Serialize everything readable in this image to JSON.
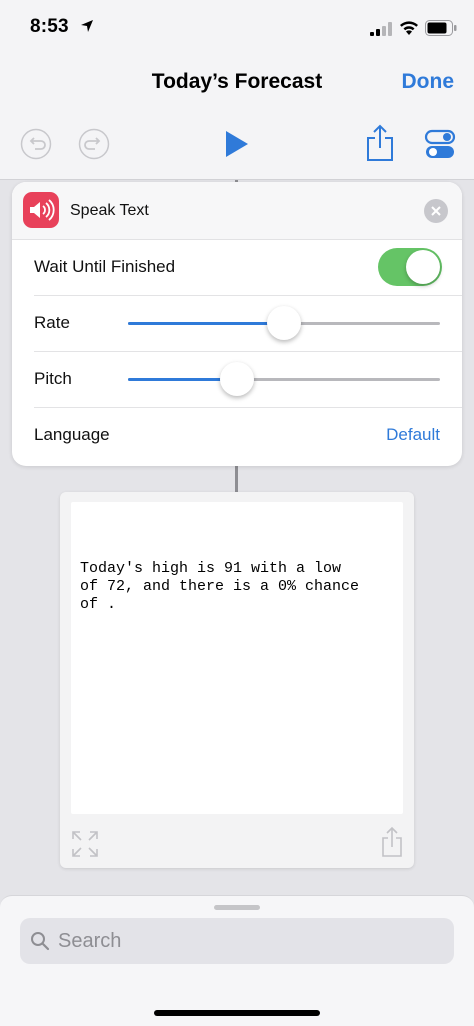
{
  "status_bar": {
    "time": "8:53"
  },
  "nav": {
    "title": "Today’s Forecast",
    "done_label": "Done"
  },
  "action": {
    "title": "Speak Text",
    "wait_label": "Wait Until Finished",
    "wait_enabled": true,
    "rate_label": "Rate",
    "rate_value": 0.5,
    "pitch_label": "Pitch",
    "pitch_value": 0.35,
    "language_label": "Language",
    "language_value": "Default"
  },
  "text_block": {
    "content": "Today's high is 91 with a low\nof 72, and there is a 0% chance\nof ."
  },
  "search": {
    "placeholder": "Search"
  },
  "colors": {
    "accent": "#2f7ad9",
    "toggle_on": "#65c466",
    "speak_icon_bg": "#e8415a"
  }
}
